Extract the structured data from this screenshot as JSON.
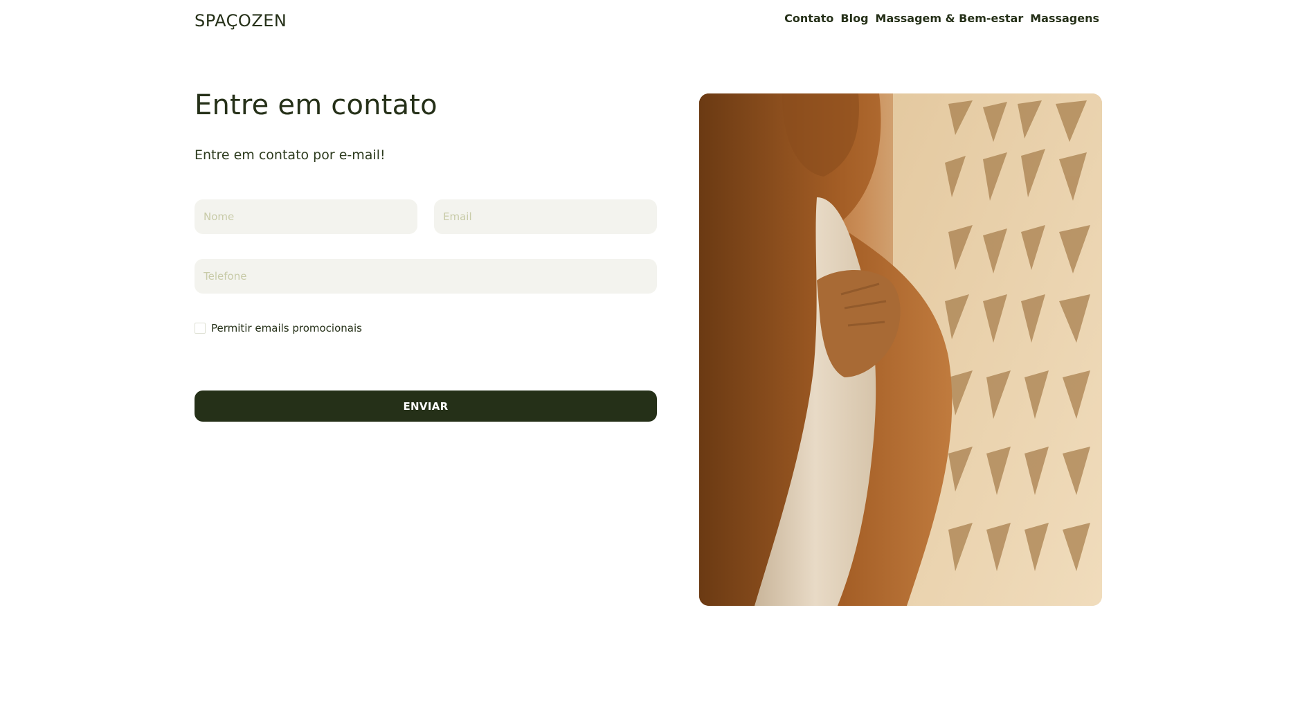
{
  "header": {
    "logo": "SPAÇOZEN",
    "nav": [
      {
        "label": "Contato"
      },
      {
        "label": "Blog"
      },
      {
        "label": "Massagem & Bem-estar"
      },
      {
        "label": "Massagens"
      }
    ]
  },
  "contact": {
    "title": "Entre em contato",
    "subtitle": "Entre em contato por e-mail!",
    "fields": {
      "name": {
        "placeholder": "Nome",
        "value": ""
      },
      "email": {
        "placeholder": "Email",
        "value": ""
      },
      "phone": {
        "placeholder": "Telefone",
        "value": ""
      }
    },
    "promo_checkbox": {
      "label": "Permitir emails promocionais",
      "checked": false
    },
    "submit_label": "ENVIAR"
  },
  "hero_image": {
    "icon": "photo-person-towel-image"
  },
  "colors": {
    "brand_dark": "#253018",
    "field_bg": "#f3f3ee",
    "placeholder": "#c8cba8"
  }
}
